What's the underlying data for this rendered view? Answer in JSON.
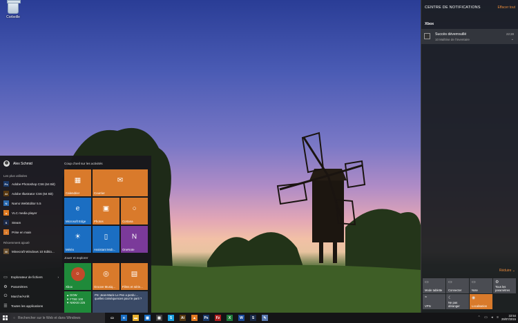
{
  "desktop": {
    "recycle_label": "Corbeille"
  },
  "start_menu": {
    "user_name": "Alex Schmid",
    "most_used_header": "Les plus utilisées",
    "most_used": [
      {
        "label": "Adobe Photoshop CS6 (64 Bit)",
        "icon": "Ps",
        "color": "#1a3a6a"
      },
      {
        "label": "Adobe Illustrator CS6 (64 Bit)",
        "icon": "Ai",
        "color": "#5a3a10"
      },
      {
        "label": "Namo WebEditor 5.5",
        "icon": "N",
        "color": "#2a6ab0"
      },
      {
        "label": "VLC media player",
        "icon": "▲",
        "color": "#e07a20"
      },
      {
        "label": "Steam",
        "icon": "S",
        "color": "#1a2a4a"
      },
      {
        "label": "Prise en main",
        "icon": "i",
        "color": "#d97a2b"
      }
    ],
    "recent_header": "Récemment ajouté",
    "recent": [
      {
        "label": "Minecraft Windows 10 Editio...",
        "icon": "M",
        "color": "#6a5030"
      }
    ],
    "bottom_items": [
      {
        "label": "Explorateur de fichiers",
        "icon": "▭",
        "arrow": "›"
      },
      {
        "label": "Paramètres",
        "icon": "⚙"
      },
      {
        "label": "Marche/Arrêt",
        "icon": "⏻"
      },
      {
        "label": "Toutes les applications",
        "icon": "☰"
      }
    ],
    "group1_title": "Coup d'oeil sur les activités",
    "group2_title": "Jouer et explorer",
    "tiles": {
      "calendar": "Calendrier",
      "mail": "Courrier",
      "edge": "Microsoft Edge",
      "photos": "Photos",
      "cortana": "Cortana",
      "weather": "Météo",
      "assistant": "Assistant Mob...",
      "onenote": "OneNote",
      "xbox": "Xbox",
      "groove": "Groove Musiq...",
      "films": "Films et série...",
      "money_lines": [
        "▲ DOW",
        "▼ FTSE 100",
        "▼ NIKKEI 225"
      ],
      "news_text": "FN: Jean-Marie Le Pen a perdu ... quelles conséquences pour le parti ?"
    }
  },
  "action_center": {
    "title": "CENTRE DE NOTIFICATIONS",
    "clear_all": "Effacer tout",
    "group": "Xbox",
    "notification": {
      "title": "Succès déverrouillé",
      "subtitle": "10 Maîtrise de l'inventaire",
      "time": "22:28"
    },
    "collapse": "Réduire ⌄",
    "quick_actions": [
      {
        "label": "Mode tablette",
        "icon": "▭",
        "on": false
      },
      {
        "label": "Connecter",
        "icon": "▭",
        "on": false
      },
      {
        "label": "Note",
        "icon": "▭",
        "on": false
      },
      {
        "label": "Tous les paramètres",
        "icon": "⚙",
        "on": false
      },
      {
        "label": "VPN",
        "icon": "≈",
        "on": false
      },
      {
        "label": "Ne pas déranger",
        "icon": "☾",
        "on": false
      },
      {
        "label": "Localisation",
        "icon": "◉",
        "on": true
      }
    ]
  },
  "taskbar": {
    "search_placeholder": "Rechercher sur le Web et dans Windows",
    "apps": [
      {
        "name": "task-view-icon",
        "glyph": "▭",
        "color": "#141416"
      },
      {
        "name": "edge-icon",
        "glyph": "e",
        "color": "#1b6ec2"
      },
      {
        "name": "explorer-icon",
        "glyph": "▬",
        "color": "#e8b030"
      },
      {
        "name": "store-icon",
        "glyph": "▦",
        "color": "#1b6ec2"
      },
      {
        "name": "calculator-icon",
        "glyph": "▦",
        "color": "#444"
      },
      {
        "name": "skype-icon",
        "glyph": "S",
        "color": "#1aa0e0"
      },
      {
        "name": "illustrator-icon",
        "glyph": "Ai",
        "color": "#5a3a10"
      },
      {
        "name": "vlc-icon",
        "glyph": "▲",
        "color": "#e07a20"
      },
      {
        "name": "photoshop-icon",
        "glyph": "Ps",
        "color": "#1a3a6a"
      },
      {
        "name": "filezilla-icon",
        "glyph": "Fz",
        "color": "#b02020"
      },
      {
        "name": "excel-icon",
        "glyph": "X",
        "color": "#1f7a3a"
      },
      {
        "name": "word-icon",
        "glyph": "W",
        "color": "#1a4a9a"
      },
      {
        "name": "steam-icon",
        "glyph": "S",
        "color": "#1a2a4a"
      },
      {
        "name": "paint-icon",
        "glyph": "✎",
        "color": "#5a7ab0"
      }
    ],
    "time": "22:54",
    "date": "29/07/2015"
  }
}
